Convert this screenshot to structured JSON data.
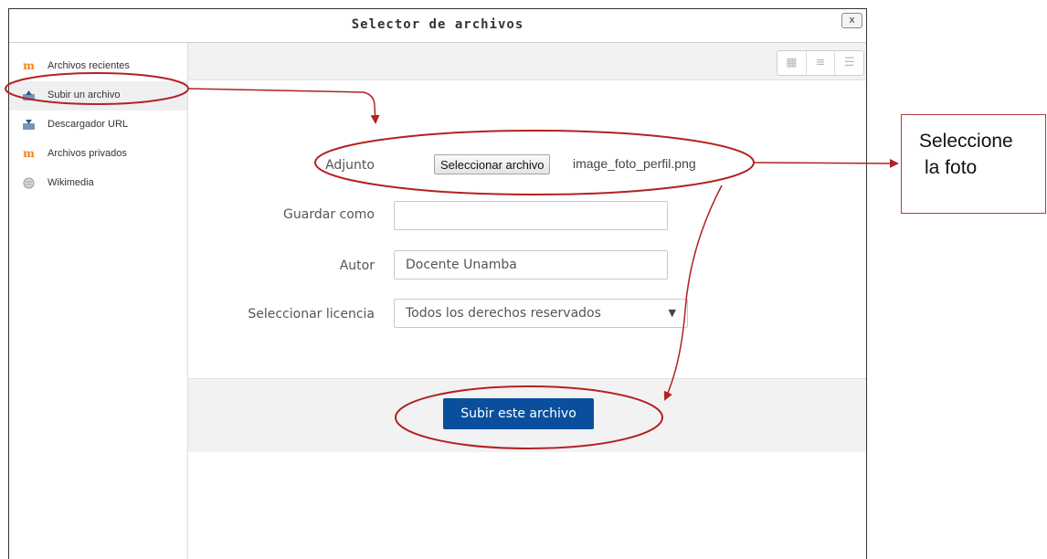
{
  "dialog": {
    "title": "Selector de archivos",
    "close_label": "x"
  },
  "sidebar": {
    "items": [
      {
        "label": "Archivos recientes",
        "icon": "moodle-icon"
      },
      {
        "label": "Subir un archivo",
        "icon": "upload-icon"
      },
      {
        "label": "Descargador URL",
        "icon": "download-icon"
      },
      {
        "label": "Archivos privados",
        "icon": "moodle-icon"
      },
      {
        "label": "Wikimedia",
        "icon": "wikimedia-icon"
      }
    ],
    "active_item": "Subir un archivo"
  },
  "toolbar": {
    "views": [
      "grid-view-icon",
      "list-view-icon",
      "tree-view-icon"
    ]
  },
  "form": {
    "attachment_label": "Adjunto",
    "file_button_label": "Seleccionar archivo",
    "file_name": "image_foto_perfil.png",
    "save_as_label": "Guardar como",
    "save_as_value": "",
    "author_label": "Autor",
    "author_value": "Docente Unamba",
    "license_label": "Seleccionar licencia",
    "license_value": "Todos los derechos reservados"
  },
  "footer": {
    "upload_button_label": "Subir este archivo"
  },
  "annotation": {
    "callout_line1": "Seleccione",
    "callout_line2": "la foto",
    "color": "#b22222"
  },
  "colors": {
    "primary_button": "#0a4f9e",
    "moodle_orange": "#f98012"
  }
}
